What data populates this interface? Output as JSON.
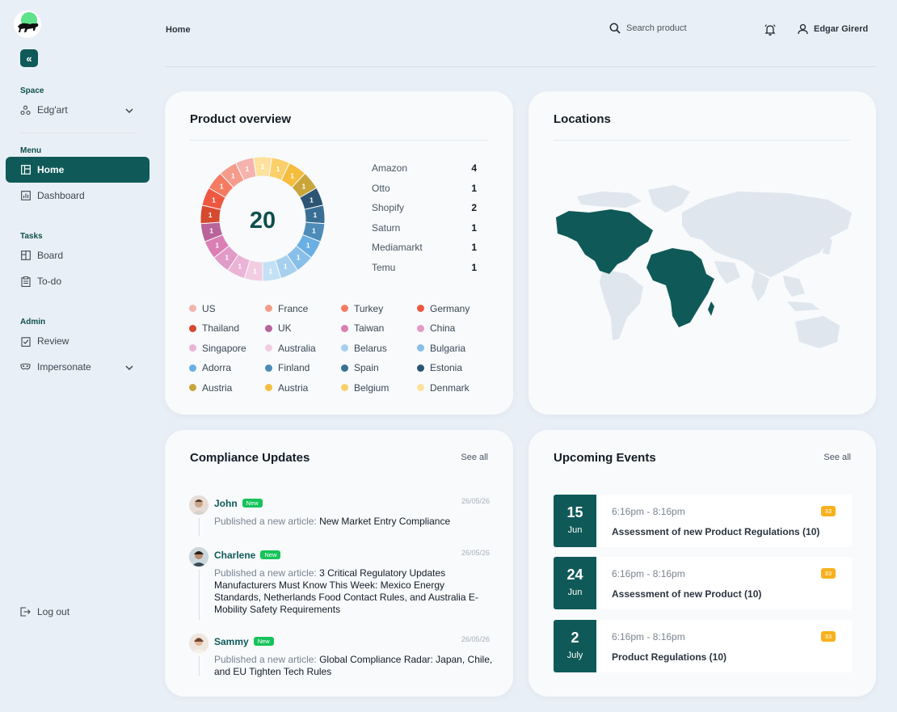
{
  "sidebar": {
    "space_label": "Space",
    "space_name": "Edg'art",
    "menu_label": "Menu",
    "menu_items": [
      {
        "label": "Home"
      },
      {
        "label": "Dashboard"
      }
    ],
    "tasks_label": "Tasks",
    "tasks_items": [
      {
        "label": "Board"
      },
      {
        "label": "To-do"
      }
    ],
    "admin_label": "Admin",
    "admin_items": [
      {
        "label": "Review"
      },
      {
        "label": "Impersonate"
      }
    ],
    "logout_label": "Log out"
  },
  "header": {
    "breadcrumb": "Home",
    "search_placeholder": "Search product",
    "user_name": "Edgar Girerd"
  },
  "product_overview": {
    "title": "Product overview",
    "total": "20",
    "platforms": [
      {
        "name": "Amazon",
        "count": "4"
      },
      {
        "name": "Otto",
        "count": "1"
      },
      {
        "name": "Shopify",
        "count": "2"
      },
      {
        "name": "Saturn",
        "count": "1"
      },
      {
        "name": "Mediamarkt",
        "count": "1"
      },
      {
        "name": "Temu",
        "count": "1"
      }
    ],
    "countries": [
      {
        "name": "US",
        "color": "#f5b3ad"
      },
      {
        "name": "France",
        "color": "#f59b8a"
      },
      {
        "name": "Turkey",
        "color": "#f47b62"
      },
      {
        "name": "Germany",
        "color": "#ee5840"
      },
      {
        "name": "Thailand",
        "color": "#d64a30"
      },
      {
        "name": "UK",
        "color": "#b8649a"
      },
      {
        "name": "Taiwan",
        "color": "#da7eb4"
      },
      {
        "name": "China",
        "color": "#e29ac7"
      },
      {
        "name": "Singapore",
        "color": "#ebb3d6"
      },
      {
        "name": "Australia",
        "color": "#f2cde2"
      },
      {
        "name": "Belarus",
        "color": "#a6d0ee"
      },
      {
        "name": "Bulgaria",
        "color": "#87bfe8"
      },
      {
        "name": "Adorra",
        "color": "#6aafe3"
      },
      {
        "name": "Finland",
        "color": "#4d8bb8"
      },
      {
        "name": "Spain",
        "color": "#3a6f95"
      },
      {
        "name": "Estonia",
        "color": "#2c5573"
      },
      {
        "name": "Austria",
        "color": "#c9a53a"
      },
      {
        "name": "Austria",
        "color": "#f6bc3d"
      },
      {
        "name": "Belgium",
        "color": "#fbd06b"
      },
      {
        "name": "Denmark",
        "color": "#fde19d"
      }
    ],
    "ring_colors": [
      "#fbd06b",
      "#f6bc3d",
      "#c9a53a",
      "#2c5573",
      "#3a6f95",
      "#4d8bb8",
      "#6aafe3",
      "#87bfe8",
      "#a6d0ee",
      "#c4e0f4",
      "#f2cde2",
      "#ebb3d6",
      "#e29ac7",
      "#da7eb4",
      "#b8649a",
      "#d64a30",
      "#ee5840",
      "#f47b62",
      "#f59b8a",
      "#f5b3ad",
      "#fde19d"
    ],
    "slice_label": "1"
  },
  "locations": {
    "title": "Locations",
    "highlight_color": "#0f5a58",
    "base_color": "#dfe6ed"
  },
  "compliance": {
    "title": "Compliance Updates",
    "see_all": "See all",
    "badge": "New",
    "items": [
      {
        "name": "John",
        "date": "26/05/26",
        "prefix": "Published a new article:",
        "title": "New Market Entry Compliance"
      },
      {
        "name": "Charlene",
        "date": "26/05/26",
        "prefix": "Published a new article:",
        "title": "3 Critical Regulatory Updates Manufacturers Must Know This Week: Mexico Energy Standards, Netherlands Food Contact Rules, and Australia E-Mobility Safety Requirements"
      },
      {
        "name": "Sammy",
        "date": "26/05/26",
        "prefix": "Published a new article:",
        "title": "Global Compliance Radar: Japan, Chile, and EU Tighten Tech Rules"
      }
    ]
  },
  "events": {
    "title": "Upcoming Events",
    "see_all": "See all",
    "items": [
      {
        "day": "15",
        "month": "Jun",
        "time": "6:16pm - 8:16pm",
        "tag": "33",
        "title": "Assessment of new Product Regulations (10)"
      },
      {
        "day": "24",
        "month": "Jun",
        "time": "6:16pm - 8:16pm",
        "tag": "33",
        "title": "Assessment of new Product (10)"
      },
      {
        "day": "2",
        "month": "July",
        "time": "6:16pm - 8:16pm",
        "tag": "33",
        "title": "Product Regulations (10)"
      }
    ]
  }
}
